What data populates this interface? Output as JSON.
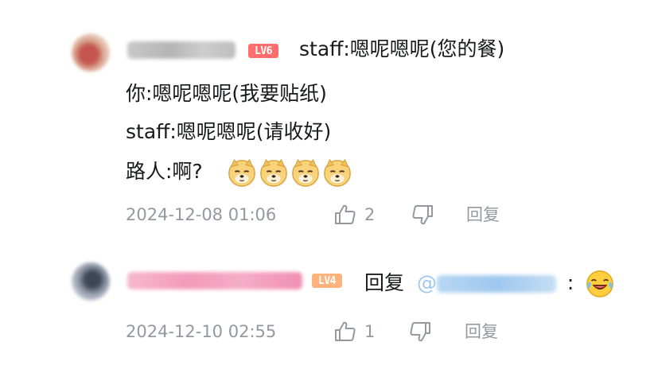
{
  "comments": [
    {
      "level": "LV6",
      "level_color": "#ff6d6d",
      "lines": [
        "staff:嗯呢嗯呢(您的餐)",
        "你:嗯呢嗯呢(我要贴纸)",
        "staff:嗯呢嗯呢(请收好)",
        "路人:啊?"
      ],
      "emojis": [
        "doge-emoji",
        "doge-emoji",
        "doge-emoji",
        "doge-emoji"
      ],
      "timestamp": "2024-12-08 01:06",
      "like_count": "2",
      "reply_label": "回复"
    },
    {
      "level": "LV4",
      "level_color": "#ffb37c",
      "reply_prefix": "回复",
      "mention_prefix": "@",
      "colon": ":",
      "emoji": "laughing-crying-emoji",
      "timestamp": "2024-12-10 02:55",
      "like_count": "1",
      "reply_label": "回复"
    }
  ],
  "icons": {
    "like": "thumbs-up-icon",
    "dislike": "thumbs-down-icon"
  },
  "colors": {
    "text": "#18191c",
    "meta": "#9499a0",
    "mention": "#9ec7ee",
    "pink_username": "#f4a7c3"
  }
}
